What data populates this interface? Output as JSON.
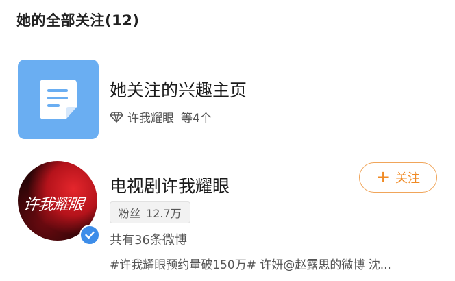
{
  "header": {
    "title": "她的全部关注(12)"
  },
  "interest": {
    "title": "她关注的兴趣主页",
    "subtitle_name": "许我耀眼",
    "subtitle_suffix": "等4个",
    "tile_color": "#6aaef2"
  },
  "account": {
    "name": "电视剧许我耀眼",
    "fans_label": "粉丝",
    "fans_count": "12.7万",
    "post_count_text": "共有36条微博",
    "latest_post": "#许我耀眼预约量破150万# 许妍@赵露思的微博 沈...",
    "follow_label": "关注",
    "verified_color": "#3d8de9",
    "avatar_logo": "许我耀眼"
  },
  "colors": {
    "accent": "#f08a24"
  }
}
